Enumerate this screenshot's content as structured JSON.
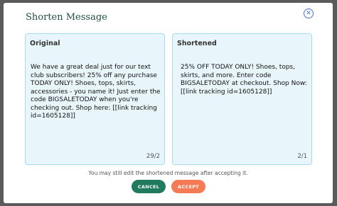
{
  "modal": {
    "title": "Shorten Message",
    "close_icon": "close-circle-icon"
  },
  "original": {
    "label": "Original",
    "text": "We have a great deal just for our text club subscribers! 25% off any purchase TODAY ONLY! Shoes, tops, skirts, accessories - you name it! Just enter the code BIGSALETODAY when you're checking out. Shop here: [[link tracking id=1605128]]",
    "counter": "29/2"
  },
  "shortened": {
    "label": "Shortened",
    "text": "25% OFF TODAY ONLY! Shoes, tops, skirts, and more. Enter code BIGSALETODAY at checkout. Shop Now: [[link tracking id=1605128]]",
    "counter": "2/1"
  },
  "footer": {
    "note": "You may still edit the shortened message after accepting it.",
    "cancel_label": "CANCEL",
    "accept_label": "ACCEPT"
  },
  "colors": {
    "overlay": "#5b5b5b",
    "title": "#1f4f45",
    "panel_bg": "#e8f6fb",
    "panel_border": "#a7dcef",
    "cancel_bg": "#1f7a5e",
    "accept_bg": "#f47b55",
    "close_icon": "#4b72c9"
  }
}
